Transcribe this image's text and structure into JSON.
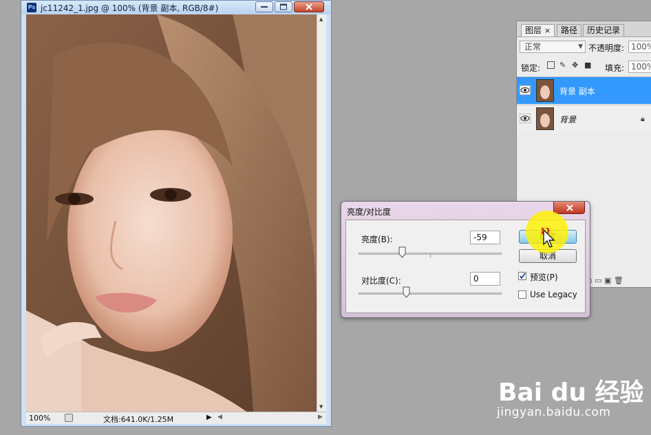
{
  "document": {
    "title": "jc11242_1.jpg @ 100% (背景 副本, RGB/8#)",
    "ps_icon": "Ps",
    "zoom": "100%",
    "doc_info": "文档:641.0K/1.25M"
  },
  "layers_panel": {
    "tabs": [
      {
        "label": "图层",
        "close": "×"
      },
      {
        "label": "路径"
      },
      {
        "label": "历史记录"
      }
    ],
    "blend_mode": "正常",
    "opacity_label": "不透明度:",
    "opacity_value": "100%",
    "lock_label": "锁定:",
    "fill_label": "填充:",
    "fill_value": "100%",
    "layers": [
      {
        "name": "背景 副本",
        "selected": true
      },
      {
        "name": "背景",
        "locked": true
      }
    ]
  },
  "dialog": {
    "title": "亮度/对比度",
    "brightness_label": "亮度(B):",
    "brightness_value": "-59",
    "brightness_slider": {
      "value": -59,
      "min": -150,
      "max": 150
    },
    "contrast_label": "对比度(C):",
    "contrast_value": "0",
    "contrast_slider": {
      "value": 0,
      "min": -50,
      "max": 100
    },
    "ok_label": "确定",
    "cancel_label": "取消",
    "preview_label": "预览(P)",
    "preview_checked": true,
    "legacy_label": "Use Legacy",
    "legacy_checked": false
  },
  "watermark": {
    "logo_text": "Bai du 经验",
    "url": "jingyan.baidu.com"
  },
  "colors": {
    "selection": "#3399ff",
    "highlight": "#fff000"
  }
}
